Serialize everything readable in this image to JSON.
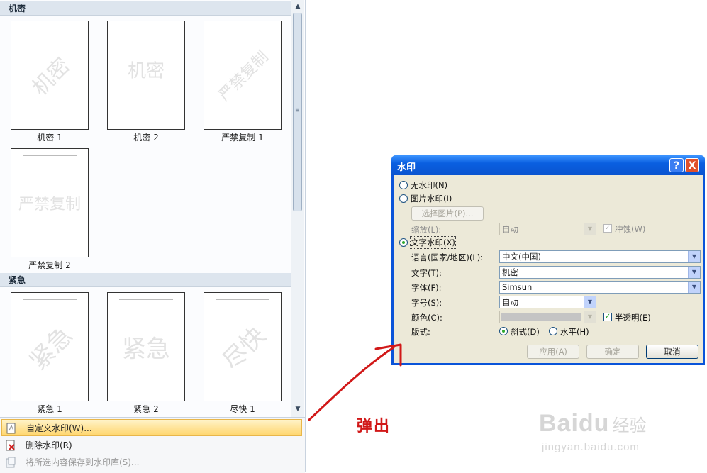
{
  "gallery": {
    "sections": [
      {
        "title": "机密",
        "items": [
          {
            "label": "机密 1",
            "watermark": "机密",
            "style": "diagonal"
          },
          {
            "label": "机密 2",
            "watermark": "机密",
            "style": "horizontal"
          },
          {
            "label": "严禁复制 1",
            "watermark": "严禁复制",
            "style": "diagonal"
          },
          {
            "label": "严禁复制 2",
            "watermark": "严禁复制",
            "style": "horizontal"
          }
        ]
      },
      {
        "title": "紧急",
        "items": [
          {
            "label": "紧急 1",
            "watermark": "紧急",
            "style": "diagonal"
          },
          {
            "label": "紧急 2",
            "watermark": "紧急",
            "style": "horizontal"
          },
          {
            "label": "尽快 1",
            "watermark": "尽快",
            "style": "diagonal"
          }
        ]
      }
    ],
    "scrollbar": {
      "up_icon": "arrow-up-icon",
      "down_icon": "arrow-down-icon"
    }
  },
  "menu": {
    "custom": "自定义水印(W)...",
    "remove": "删除水印(R)",
    "save": "将所选内容保存到水印库(S)..."
  },
  "dialog": {
    "title": "水印",
    "help": "?",
    "close": "X",
    "no_watermark": "无水印(N)",
    "picture_watermark": "图片水印(I)",
    "select_picture": "选择图片(P)...",
    "scale_label": "缩放(L):",
    "scale_value": "自动",
    "washout": "冲蚀(W)",
    "text_watermark": "文字水印(X)",
    "language_label": "语言(国家/地区)(L):",
    "language_value": "中文(中国)",
    "text_label": "文字(T):",
    "text_value": "机密",
    "font_label": "字体(F):",
    "font_value": "Simsun",
    "size_label": "字号(S):",
    "size_value": "自动",
    "color_label": "颜色(C):",
    "semitransparent": "半透明(E)",
    "layout_label": "版式:",
    "diagonal": "斜式(D)",
    "horizontal": "水平(H)",
    "apply": "应用(A)",
    "ok": "确定",
    "cancel": "取消"
  },
  "annotation": {
    "text": "弹出",
    "color": "#d11818"
  },
  "brand": {
    "logo": "Baidu",
    "cn": "经验",
    "url": "jingyan.baidu.com"
  }
}
